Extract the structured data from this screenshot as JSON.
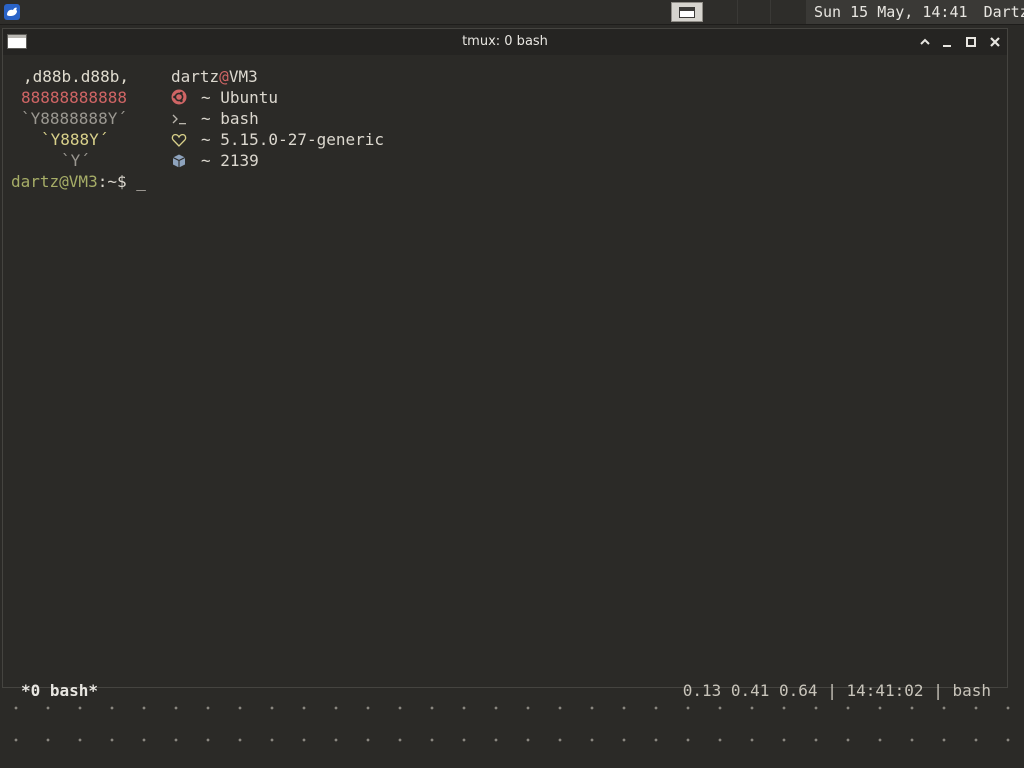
{
  "panel": {
    "clock": "Sun 15 May, 14:41",
    "user": "Dartz"
  },
  "window": {
    "title": "tmux: 0 bash"
  },
  "fetch": {
    "art": [
      ",d88b.d88b,",
      "88888888888",
      "`Y8888888Y´",
      "`Y888Y´",
      "`Y´"
    ],
    "user": "dartz",
    "at": "@",
    "host": "VM3",
    "rows": [
      {
        "icon": "ubuntu-icon",
        "text": "~ Ubuntu",
        "color": "#d06565"
      },
      {
        "icon": "terminal-prompt-icon",
        "text": "~ bash",
        "color": "#b9b5ac"
      },
      {
        "icon": "heart-icon",
        "text": "~ 5.15.0-27-generic",
        "color": "#d8d08a"
      },
      {
        "icon": "package-icon",
        "text": "~ 2139",
        "color": "#8ea3bd"
      }
    ]
  },
  "prompt": {
    "user_host": "dartz@VM3",
    "path": ":~$",
    "cursor": "_"
  },
  "tmux_status": {
    "window_name": "*0 bash*",
    "load": "0.13 0.41 0.64",
    "sep1": "|",
    "time": "14:41:02",
    "sep2": "|",
    "command": "bash"
  }
}
